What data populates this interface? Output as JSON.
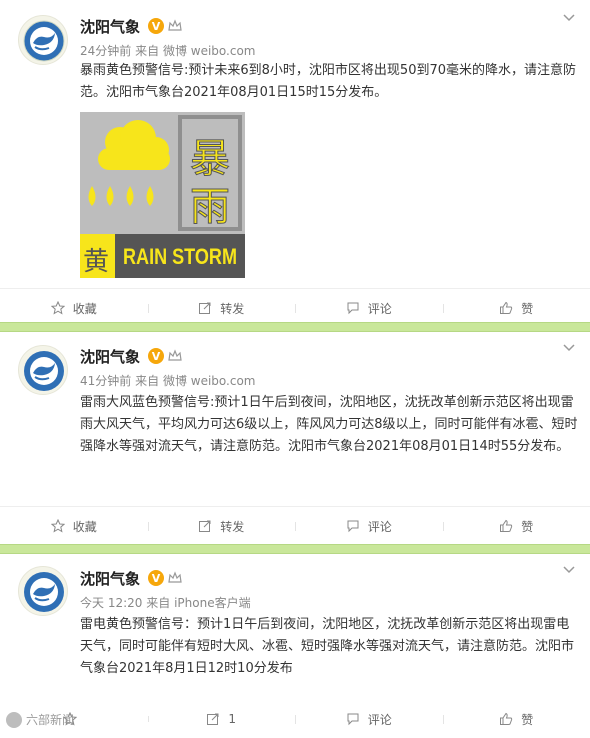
{
  "posts": [
    {
      "author": "沈阳气象",
      "verified_badge": "V",
      "meta_time": "24分钟前",
      "meta_source_prefix": "来自",
      "meta_source": "微博 weibo.com",
      "text": "暴雨黄色预警信号:预计未来6到8小时，沈阳市区将出现50到70毫米的降水，请注意防范。沈阳市气象台2021年08月01日15时15分发布。",
      "image": {
        "big_chars": [
          "暴",
          "雨"
        ],
        "small_char": "黄",
        "caption": "RAIN STORM",
        "colors": {
          "warning_yellow": "#f7e51b",
          "gray": "#bdbdbd"
        }
      },
      "actions": {
        "favorite": "收藏",
        "repost": "转发",
        "comment": "评论",
        "like": "赞"
      }
    },
    {
      "author": "沈阳气象",
      "verified_badge": "V",
      "meta_time": "41分钟前",
      "meta_source_prefix": "来自",
      "meta_source": "微博 weibo.com",
      "text": "雷雨大风蓝色预警信号:预计1日午后到夜间，沈阳地区，沈抚改革创新示范区将出现雷雨大风天气，平均风力可达6级以上，阵风风力可达8级以上，同时可能伴有冰雹、短时强降水等强对流天气，请注意防范。沈阳市气象台2021年08月01日14时55分发布。",
      "actions": {
        "favorite": "收藏",
        "repost": "转发",
        "comment": "评论",
        "like": "赞"
      }
    },
    {
      "author": "沈阳气象",
      "verified_badge": "V",
      "meta_time": "今天 12:20",
      "meta_source_prefix": "来自",
      "meta_source": "iPhone客户端",
      "text": "雷电黄色预警信号：预计1日午后到夜间，沈阳地区，沈抚改革创新示范区将出现雷电天气，同时可能伴有短时大风、冰雹、短时强降水等强对流天气，请注意防范。沈阳市气象台2021年8月1日12时10分发布",
      "actions": {
        "favorite": "",
        "repost": "1",
        "comment": "评论",
        "like": "赞"
      }
    }
  ],
  "watermark": "六部新闻",
  "colors": {
    "separator": "#c9e79a",
    "badge": "#f6a70b",
    "avatar_blue": "#2f6fb5"
  }
}
